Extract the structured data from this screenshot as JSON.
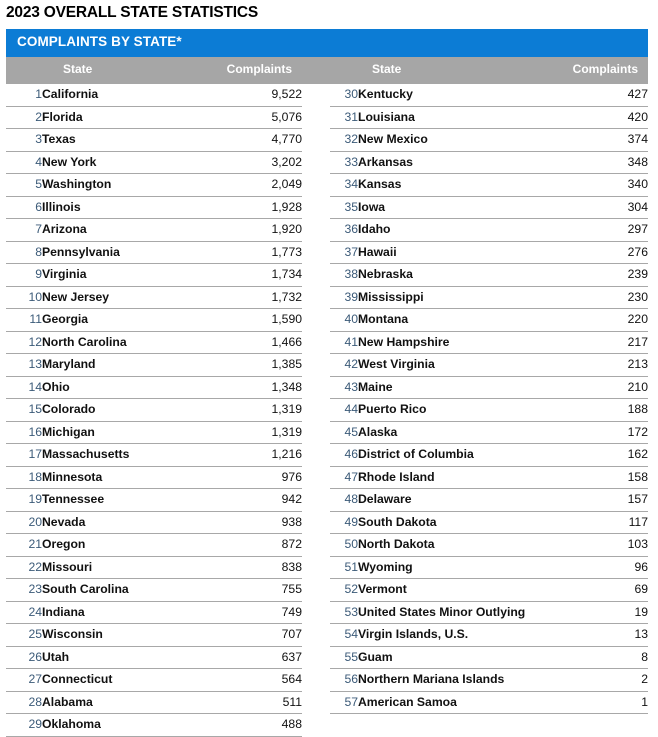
{
  "title": "2023 OVERALL STATE STATISTICS",
  "banner": {
    "label": "COMPLAINTS BY STATE*"
  },
  "colors": {
    "banner_blue": "#0c7cd5",
    "header_gray": "#a6a6a6",
    "rule": "#a8a8a8",
    "rank_text": "#3b5a78",
    "body_text": "#111111"
  },
  "columns": {
    "left": {
      "state_header": "State",
      "complaints_header": "Complaints"
    },
    "right": {
      "state_header": "State",
      "complaints_header": "Complaints"
    }
  },
  "chart_data": {
    "type": "table",
    "title": "2023 OVERALL STATE STATISTICS — COMPLAINTS BY STATE*",
    "columns": [
      "Rank",
      "State",
      "Complaints"
    ],
    "rows_left": [
      {
        "rank": "1",
        "state": "California",
        "complaints": "9,522"
      },
      {
        "rank": "2",
        "state": "Florida",
        "complaints": "5,076"
      },
      {
        "rank": "3",
        "state": "Texas",
        "complaints": "4,770"
      },
      {
        "rank": "4",
        "state": "New York",
        "complaints": "3,202"
      },
      {
        "rank": "5",
        "state": "Washington",
        "complaints": "2,049"
      },
      {
        "rank": "6",
        "state": "Illinois",
        "complaints": "1,928"
      },
      {
        "rank": "7",
        "state": "Arizona",
        "complaints": "1,920"
      },
      {
        "rank": "8",
        "state": "Pennsylvania",
        "complaints": "1,773"
      },
      {
        "rank": "9",
        "state": "Virginia",
        "complaints": "1,734"
      },
      {
        "rank": "10",
        "state": "New Jersey",
        "complaints": "1,732"
      },
      {
        "rank": "11",
        "state": "Georgia",
        "complaints": "1,590"
      },
      {
        "rank": "12",
        "state": "North Carolina",
        "complaints": "1,466"
      },
      {
        "rank": "13",
        "state": "Maryland",
        "complaints": "1,385"
      },
      {
        "rank": "14",
        "state": "Ohio",
        "complaints": "1,348"
      },
      {
        "rank": "15",
        "state": "Colorado",
        "complaints": "1,319"
      },
      {
        "rank": "16",
        "state": "Michigan",
        "complaints": "1,319"
      },
      {
        "rank": "17",
        "state": "Massachusetts",
        "complaints": "1,216"
      },
      {
        "rank": "18",
        "state": "Minnesota",
        "complaints": "976"
      },
      {
        "rank": "19",
        "state": "Tennessee",
        "complaints": "942"
      },
      {
        "rank": "20",
        "state": "Nevada",
        "complaints": "938"
      },
      {
        "rank": "21",
        "state": "Oregon",
        "complaints": "872"
      },
      {
        "rank": "22",
        "state": "Missouri",
        "complaints": "838"
      },
      {
        "rank": "23",
        "state": "South Carolina",
        "complaints": "755"
      },
      {
        "rank": "24",
        "state": "Indiana",
        "complaints": "749"
      },
      {
        "rank": "25",
        "state": "Wisconsin",
        "complaints": "707"
      },
      {
        "rank": "26",
        "state": "Utah",
        "complaints": "637"
      },
      {
        "rank": "27",
        "state": "Connecticut",
        "complaints": "564"
      },
      {
        "rank": "28",
        "state": "Alabama",
        "complaints": "511"
      },
      {
        "rank": "29",
        "state": "Oklahoma",
        "complaints": "488"
      }
    ],
    "rows_right": [
      {
        "rank": "30",
        "state": "Kentucky",
        "complaints": "427"
      },
      {
        "rank": "31",
        "state": "Louisiana",
        "complaints": "420"
      },
      {
        "rank": "32",
        "state": "New Mexico",
        "complaints": "374"
      },
      {
        "rank": "33",
        "state": "Arkansas",
        "complaints": "348"
      },
      {
        "rank": "34",
        "state": "Kansas",
        "complaints": "340"
      },
      {
        "rank": "35",
        "state": "Iowa",
        "complaints": "304"
      },
      {
        "rank": "36",
        "state": "Idaho",
        "complaints": "297"
      },
      {
        "rank": "37",
        "state": "Hawaii",
        "complaints": "276"
      },
      {
        "rank": "38",
        "state": "Nebraska",
        "complaints": "239"
      },
      {
        "rank": "39",
        "state": "Mississippi",
        "complaints": "230"
      },
      {
        "rank": "40",
        "state": "Montana",
        "complaints": "220"
      },
      {
        "rank": "41",
        "state": "New Hampshire",
        "complaints": "217"
      },
      {
        "rank": "42",
        "state": "West Virginia",
        "complaints": "213"
      },
      {
        "rank": "43",
        "state": "Maine",
        "complaints": "210"
      },
      {
        "rank": "44",
        "state": "Puerto Rico",
        "complaints": "188"
      },
      {
        "rank": "45",
        "state": "Alaska",
        "complaints": "172"
      },
      {
        "rank": "46",
        "state": "District of Columbia",
        "complaints": "162"
      },
      {
        "rank": "47",
        "state": "Rhode Island",
        "complaints": "158"
      },
      {
        "rank": "48",
        "state": "Delaware",
        "complaints": "157"
      },
      {
        "rank": "49",
        "state": "South Dakota",
        "complaints": "117"
      },
      {
        "rank": "50",
        "state": "North Dakota",
        "complaints": "103"
      },
      {
        "rank": "51",
        "state": "Wyoming",
        "complaints": "96"
      },
      {
        "rank": "52",
        "state": "Vermont",
        "complaints": "69"
      },
      {
        "rank": "53",
        "state": "United States Minor Outlying",
        "complaints": "19"
      },
      {
        "rank": "54",
        "state": "Virgin Islands, U.S.",
        "complaints": "13"
      },
      {
        "rank": "55",
        "state": "Guam",
        "complaints": "8"
      },
      {
        "rank": "56",
        "state": "Northern Mariana Islands",
        "complaints": "2"
      },
      {
        "rank": "57",
        "state": "American Samoa",
        "complaints": "1"
      }
    ]
  }
}
